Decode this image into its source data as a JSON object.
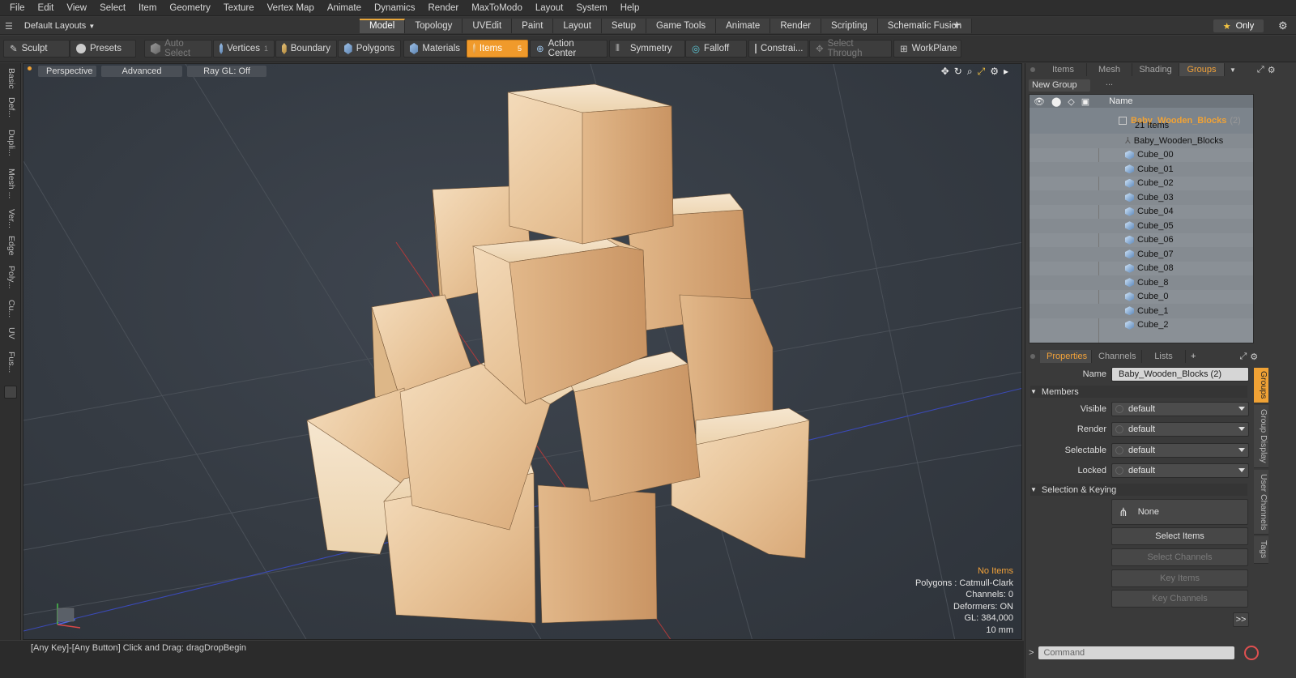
{
  "menu": [
    "File",
    "Edit",
    "View",
    "Select",
    "Item",
    "Geometry",
    "Texture",
    "Vertex Map",
    "Animate",
    "Dynamics",
    "Render",
    "MaxToModo",
    "Layout",
    "System",
    "Help"
  ],
  "layout": {
    "selector": "Default Layouts",
    "only": "Only",
    "tabs": [
      "Model",
      "Topology",
      "UVEdit",
      "Paint",
      "Layout",
      "Setup",
      "Game Tools",
      "Animate",
      "Render",
      "Scripting",
      "Schematic Fusion"
    ],
    "active_tab": "Model"
  },
  "toolbar": {
    "sculpt": "Sculpt",
    "presets": "Presets",
    "auto_select": "Auto Select",
    "vertices": "Vertices",
    "vertices_count": "1",
    "boundary": "Boundary",
    "polygons": "Polygons",
    "materials": "Materials",
    "items": "Items",
    "items_count": "5",
    "action_center": "Action Center",
    "symmetry": "Symmetry",
    "falloff": "Falloff",
    "constraints": "Constrai...",
    "select_through": "Select Through",
    "workplane": "WorkPlane"
  },
  "left_tabs": [
    "Basic",
    "Def...",
    "Dupli...",
    "Mesh ...",
    "Ver...",
    "Edge",
    "Poly...",
    "Cu...",
    "UV",
    "Fus..."
  ],
  "viewport": {
    "perspective": "Perspective",
    "advanced": "Advanced",
    "raygl": "Ray GL: Off",
    "info": {
      "no_items": "No Items",
      "polygons": "Polygons : Catmull-Clark",
      "channels": "Channels: 0",
      "deformers": "Deformers: ON",
      "gl": "GL: 384,000",
      "scale": "10 mm"
    }
  },
  "status": "[Any Key]-[Any Button] Click and Drag:  dragDropBegin",
  "groups_panel": {
    "tabs": [
      "Items",
      "Mesh ...",
      "Shading",
      "Groups"
    ],
    "active": "Groups",
    "new_group": "New Group",
    "name_header": "Name",
    "group_name": "Baby_Wooden_Blocks",
    "group_count": "(2)",
    "items_count": "21 Items",
    "items": [
      "Baby_Wooden_Blocks",
      "Cube_00",
      "Cube_01",
      "Cube_02",
      "Cube_03",
      "Cube_04",
      "Cube_05",
      "Cube_06",
      "Cube_07",
      "Cube_08",
      "Cube_8",
      "Cube_0",
      "Cube_1",
      "Cube_2"
    ]
  },
  "properties": {
    "tabs": [
      "Properties",
      "Channels",
      "Lists"
    ],
    "plus": "+",
    "name_label": "Name",
    "name_value": "Baby_Wooden_Blocks (2)",
    "members": "Members",
    "visible_label": "Visible",
    "visible": "default",
    "render_label": "Render",
    "render": "default",
    "selectable_label": "Selectable",
    "selectable": "default",
    "locked_label": "Locked",
    "locked": "default",
    "selection_keying": "Selection & Keying",
    "none": "None",
    "select_items": "Select Items",
    "select_channels": "Select Channels",
    "key_items": "Key Items",
    "key_channels": "Key Channels",
    "more": ">>"
  },
  "side_tabs": [
    "Groups",
    "Group Display",
    "User Channels",
    "Tags"
  ],
  "command": {
    "placeholder": "Command"
  }
}
